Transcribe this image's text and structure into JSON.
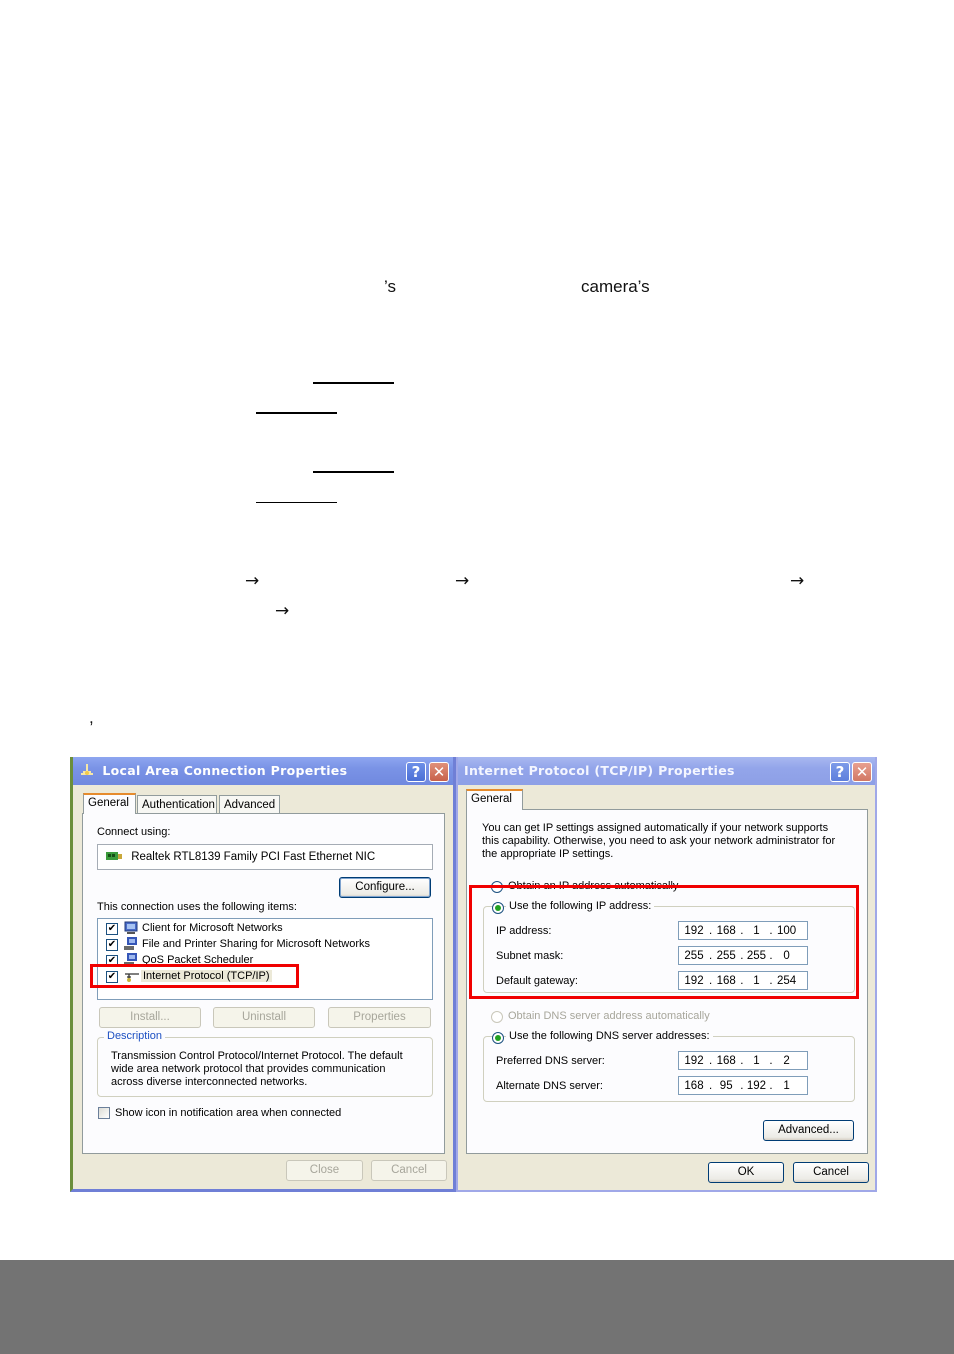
{
  "document": {
    "text_fragments": {
      "possessive_s": "’s",
      "camera_possessive": "camera’s",
      "stray_comma": ","
    },
    "arrow_glyph": "→"
  },
  "left_window": {
    "title": "Local Area Connection Properties",
    "title_icon": "network-connection-icon",
    "help_label": "?",
    "close_label": "✕",
    "tabs": [
      {
        "label": "General",
        "active": true
      },
      {
        "label": "Authentication",
        "active": false
      },
      {
        "label": "Advanced",
        "active": false
      }
    ],
    "connect_using_label": "Connect using:",
    "adapter_name": "Realtek RTL8139 Family PCI Fast Ethernet NIC",
    "configure_button": "Configure...",
    "items_label": "This connection uses the following items:",
    "items": [
      {
        "label": "Client for Microsoft Networks",
        "checked": true,
        "icon": "network-client-icon"
      },
      {
        "label": "File and Printer Sharing for Microsoft Networks",
        "checked": true,
        "icon": "file-printer-sharing-icon"
      },
      {
        "label": "QoS Packet Scheduler",
        "checked": true,
        "icon": "qos-scheduler-icon"
      },
      {
        "label": "Internet Protocol (TCP/IP)",
        "checked": true,
        "icon": "protocol-icon",
        "selected": true,
        "highlighted": true
      }
    ],
    "install_button": "Install...",
    "uninstall_button": "Uninstall",
    "properties_button": "Properties",
    "description_title": "Description",
    "description_text_lines": [
      "Transmission Control Protocol/Internet Protocol. The default",
      "wide area network protocol that provides communication",
      "across diverse interconnected networks."
    ],
    "show_icon_label": "Show icon in notification area when connected",
    "show_icon_checked": false,
    "close_button": "Close",
    "cancel_button": "Cancel"
  },
  "right_window": {
    "title": "Internet Protocol (TCP/IP) Properties",
    "help_label": "?",
    "close_label": "✕",
    "tabs": [
      {
        "label": "General",
        "active": true
      }
    ],
    "intro_lines": [
      "You can get IP settings assigned automatically if your network supports",
      "this capability. Otherwise, you need to ask your network administrator for",
      "the appropriate IP settings."
    ],
    "obtain_ip_auto": "Obtain an IP address automatically",
    "use_following_ip": "Use the following IP address:",
    "ip_fields": [
      {
        "label": "IP address:",
        "octets": [
          "192",
          "168",
          "1",
          "100"
        ]
      },
      {
        "label": "Subnet mask:",
        "octets": [
          "255",
          "255",
          "255",
          "0"
        ]
      },
      {
        "label": "Default gateway:",
        "octets": [
          "192",
          "168",
          "1",
          "254"
        ]
      }
    ],
    "obtain_dns_auto": "Obtain DNS server address automatically",
    "use_following_dns": "Use the following DNS server addresses:",
    "dns_fields": [
      {
        "label": "Preferred DNS server:",
        "octets": [
          "192",
          "168",
          "1",
          "2"
        ]
      },
      {
        "label": "Alternate DNS server:",
        "octets": [
          "168",
          "95",
          "192",
          "1"
        ]
      }
    ],
    "advanced_button": "Advanced...",
    "ok_button": "OK",
    "cancel_button": "Cancel"
  },
  "colors": {
    "highlight_red": "#f00000",
    "xp_titlebar_blue": "#7a93e6",
    "dialog_bg": "#ece9d8",
    "footer_gray": "#737373"
  }
}
